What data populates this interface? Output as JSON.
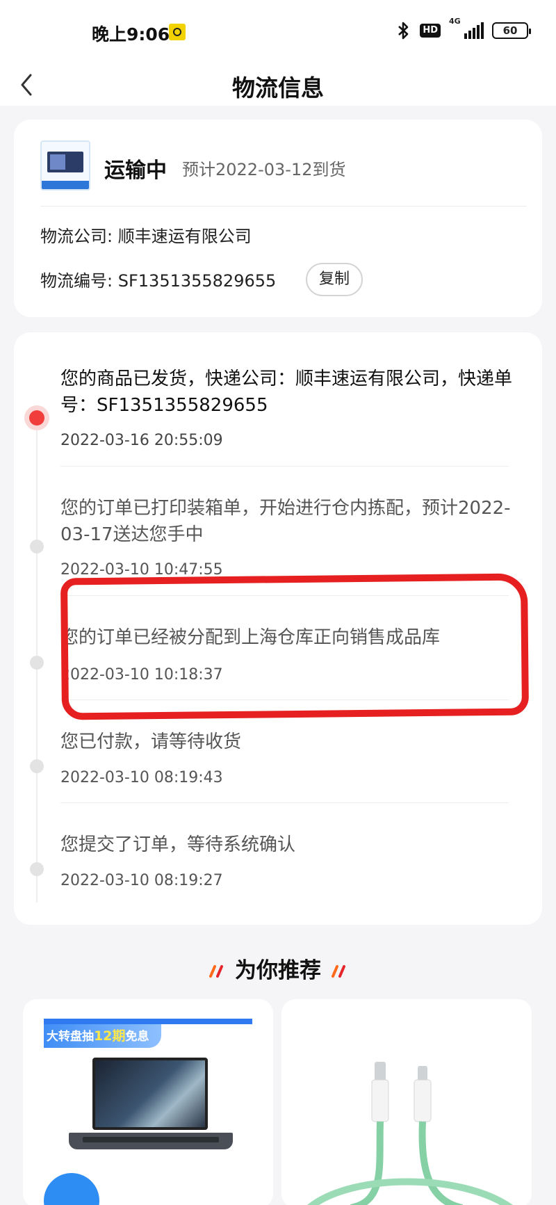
{
  "status_bar": {
    "time": "晚上9:06",
    "hd": "HD",
    "network": "4G",
    "battery": "60"
  },
  "nav": {
    "title": "物流信息"
  },
  "shipment": {
    "status": "运输中",
    "eta": "预计2022-03-12到货",
    "company_label": "物流公司:",
    "company": "顺丰速运有限公司",
    "number_label": "物流编号:",
    "number": "SF1351355829655",
    "copy_label": "复制"
  },
  "timeline": [
    {
      "text": "您的商品已发货，快递公司：顺丰速运有限公司，快递单号：SF1351355829655",
      "time": "2022-03-16 20:55:09",
      "active": true
    },
    {
      "text": "您的订单已打印装箱单，开始进行仓内拣配，预计2022-03-17送达您手中",
      "time": "2022-03-10 10:47:55",
      "active": false
    },
    {
      "text": "您的订单已经被分配到上海仓库正向销售成品库",
      "time": "2022-03-10 10:18:37",
      "active": false
    },
    {
      "text": "您已付款，请等待收货",
      "time": "2022-03-10 08:19:43",
      "active": false
    },
    {
      "text": "您提交了订单，等待系统确认",
      "time": "2022-03-10 08:19:27",
      "active": false
    }
  ],
  "recommend": {
    "title": "为你推荐",
    "products": [
      {
        "promo_prefix": "大转盘抽",
        "promo_highlight": "12期",
        "promo_suffix": "免息"
      },
      {}
    ]
  },
  "colors": {
    "accent_red": "#f23d3d",
    "annotation_red": "#e62020",
    "background": "#f5f5f7",
    "card": "#ffffff"
  }
}
